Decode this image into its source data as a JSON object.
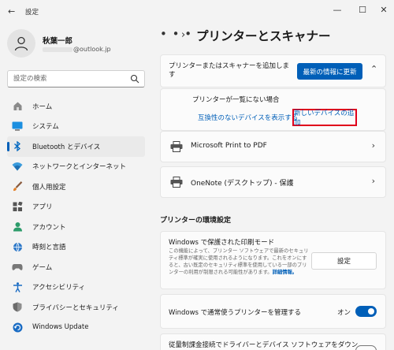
{
  "window": {
    "title": "設定",
    "minimize": "—",
    "maximize": "☐",
    "close": "✕"
  },
  "profile": {
    "name": "秋葉一郎",
    "email_suffix": "@outlook.jp"
  },
  "search": {
    "placeholder": "設定の検索"
  },
  "sidebar": {
    "items": [
      {
        "label": "ホーム",
        "icon": "home-icon",
        "selected": false
      },
      {
        "label": "システム",
        "icon": "system-icon",
        "selected": false
      },
      {
        "label": "Bluetooth とデバイス",
        "icon": "bluetooth-icon",
        "selected": true
      },
      {
        "label": "ネットワークとインターネット",
        "icon": "wifi-icon",
        "selected": false
      },
      {
        "label": "個人用設定",
        "icon": "brush-icon",
        "selected": false
      },
      {
        "label": "アプリ",
        "icon": "apps-icon",
        "selected": false
      },
      {
        "label": "アカウント",
        "icon": "account-icon",
        "selected": false
      },
      {
        "label": "時刻と言語",
        "icon": "time-language-icon",
        "selected": false
      },
      {
        "label": "ゲーム",
        "icon": "gamepad-icon",
        "selected": false
      },
      {
        "label": "アクセシビリティ",
        "icon": "accessibility-icon",
        "selected": false
      },
      {
        "label": "プライバシーとセキュリティ",
        "icon": "shield-icon",
        "selected": false
      },
      {
        "label": "Windows Update",
        "icon": "update-icon",
        "selected": false
      }
    ]
  },
  "header": {
    "ellipsis": "• • •",
    "chevron": "›",
    "title": "プリンターとスキャナー"
  },
  "add_device": {
    "label": "プリンターまたはスキャナーを追加します",
    "refresh_button": "最新の情報に更新",
    "not_listed": "プリンターが一覧にない場合",
    "legacy_link": "互換性のないデバイスを表示する",
    "add_new_link": "新しいデバイスの追加"
  },
  "printers": [
    {
      "name": "Microsoft Print to PDF"
    },
    {
      "name": "OneNote (デスクトップ) - 保護"
    }
  ],
  "prefs": {
    "section_title": "プリンターの環境設定",
    "spooler_title": "Windows で保護された印刷モード",
    "spooler_desc": "この機能によって、プリンター ソフトウェアで最新のセキュリティ標準が確実に使用されるようになります。これをオンにすると、古い既定のセキュリティ標準を使用している一部のプリンターの利用が制限される可能性があります。",
    "spooler_more": "詳細情報。",
    "settings_button": "設定",
    "manage_label": "Windows で通常使うプリンターを管理する",
    "manage_state": "オン",
    "metered_label": "従量制課金接続でドライバーとデバイス ソフトウェアをダウン"
  },
  "colors": {
    "accent": "#005fb8",
    "highlight_box": "#e0001b"
  }
}
